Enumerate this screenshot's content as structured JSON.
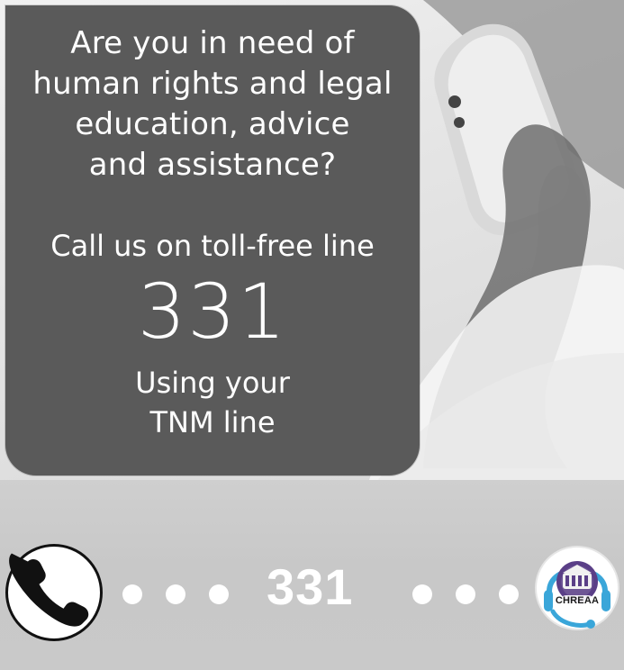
{
  "poster": {
    "question": "Are you in need of\nhuman rights and legal\neducation, advice\nand assistance?",
    "call_line": "Call us on toll-free line",
    "number_large": "331",
    "using_line": "Using your\nTNM line"
  },
  "footer": {
    "number": "331",
    "logo_text": "CHREAA"
  },
  "icons": {
    "call_icon": "phone-handset",
    "logo_icon": "chreaa-emblem-with-headset"
  },
  "colors": {
    "panel_bg": "#5a5a5a",
    "band_bg": "#c9c9c9",
    "text_white": "#ffffff",
    "logo_blue": "#3aa6d9",
    "logo_purple": "#5a3f87"
  }
}
